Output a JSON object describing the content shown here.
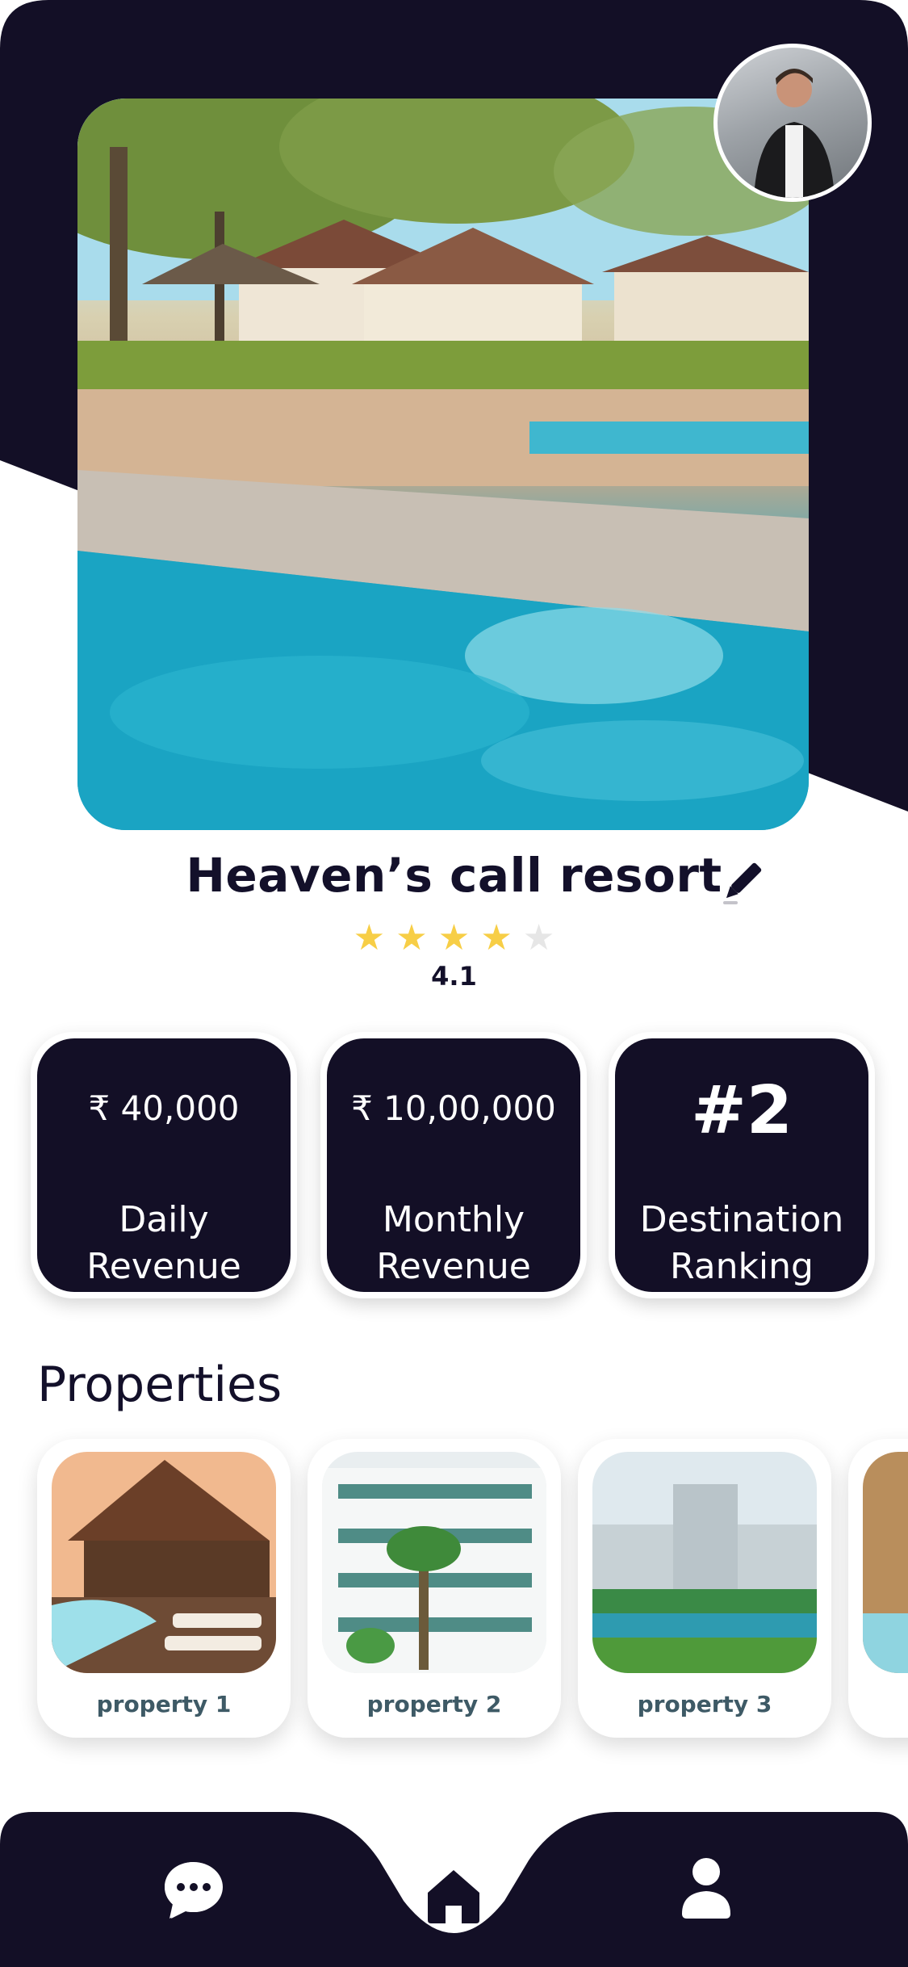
{
  "resort": {
    "name": "Heaven’s call resort",
    "rating": "4.1",
    "stars_filled": 4,
    "stars_total": 5
  },
  "stats": [
    {
      "value": "₹ 40,000",
      "label_line1": "Daily",
      "label_line2": "Revenue"
    },
    {
      "value": "₹ 10,00,000",
      "label_line1": "Monthly",
      "label_line2": "Revenue"
    },
    {
      "value": "#2",
      "label_line1": "Destination",
      "label_line2": "Ranking"
    }
  ],
  "properties_section": {
    "title": "Properties",
    "items": [
      {
        "label": "property 1"
      },
      {
        "label": "property 2"
      },
      {
        "label": "property 3"
      }
    ]
  },
  "icons": {
    "edit": "pencil-icon",
    "nav_chat": "chat-icon",
    "nav_home": "home-icon",
    "nav_profile": "user-icon"
  },
  "colors": {
    "dark": "#130f26",
    "star": "#f7ce46",
    "star_empty": "#e6e6e6",
    "label": "#3e5a66"
  }
}
